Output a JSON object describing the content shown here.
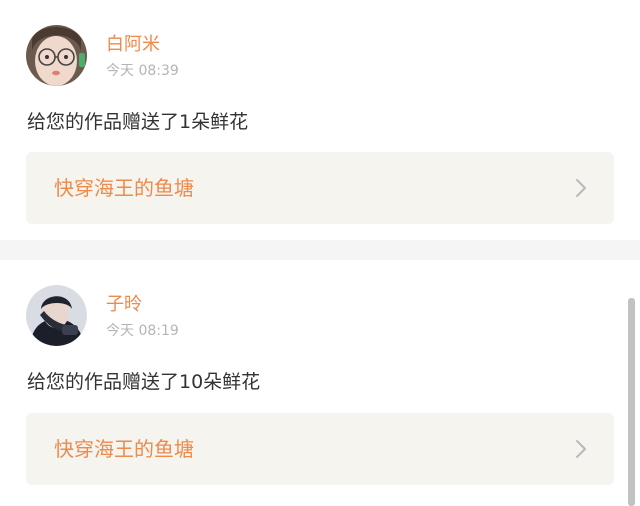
{
  "notifications": [
    {
      "user_name": "白阿米",
      "time": "今天 08:39",
      "message": "给您的作品赠送了1朵鲜花",
      "work_title": "快穿海王的鱼塘",
      "avatar_icon": "avatar-girl-with-glasses"
    },
    {
      "user_name": "子昤",
      "time": "今天 08:19",
      "message": "给您的作品赠送了10朵鲜花",
      "work_title": "快穿海王的鱼塘",
      "avatar_icon": "avatar-dark-portrait"
    }
  ],
  "colors": {
    "accent": "#ee8a4a",
    "link_background": "#f5f4ef",
    "separator": "#f5f5f5",
    "meta_text": "#b5b5b5"
  },
  "icons": {
    "link_arrow": "chevron-right-icon"
  }
}
